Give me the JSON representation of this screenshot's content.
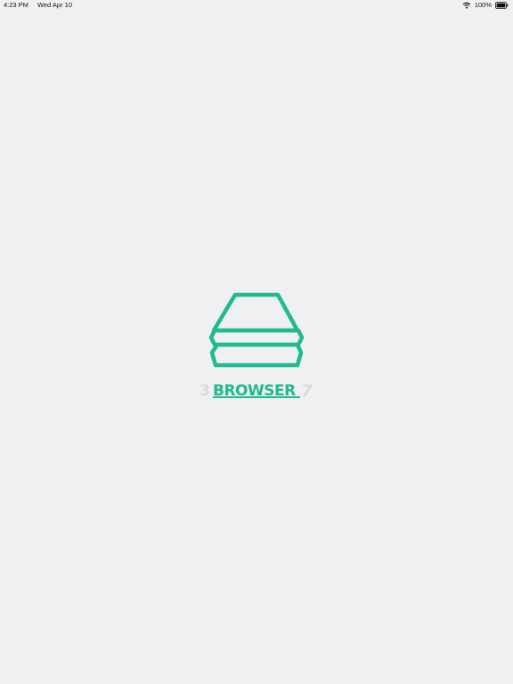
{
  "status_bar": {
    "time": "4:23 PM",
    "date": "Wed Apr 10",
    "battery": "100%",
    "icons": [
      "wifi-icon",
      "battery-icon"
    ]
  },
  "splash": {
    "logo_icon": "stacked-layers-icon",
    "wordmark": "BROWSER",
    "wordmark_prefix": "3",
    "wordmark_suffix": "7",
    "accent_color": "#1fba91",
    "background_color": "#eff0f2"
  }
}
